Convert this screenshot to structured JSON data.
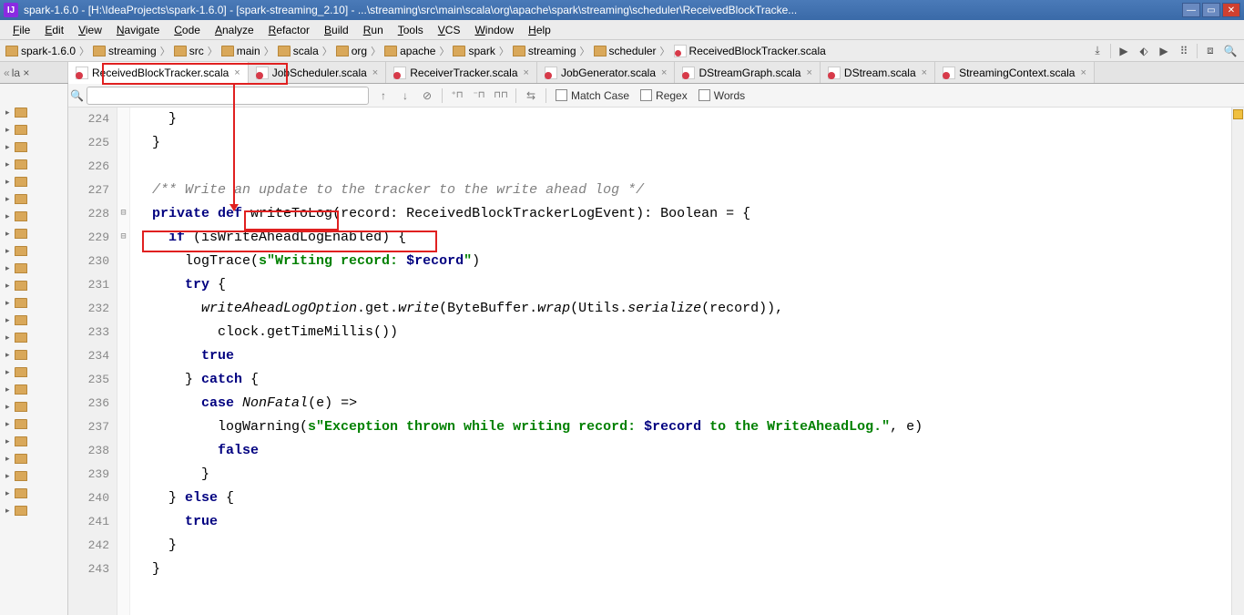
{
  "titlebar": {
    "text": "spark-1.6.0 - [H:\\IdeaProjects\\spark-1.6.0] - [spark-streaming_2.10] - ...\\streaming\\src\\main\\scala\\org\\apache\\spark\\streaming\\scheduler\\ReceivedBlockTracke..."
  },
  "menus": [
    "File",
    "Edit",
    "View",
    "Navigate",
    "Code",
    "Analyze",
    "Refactor",
    "Build",
    "Run",
    "Tools",
    "VCS",
    "Window",
    "Help"
  ],
  "breadcrumbs": [
    "spark-1.6.0",
    "streaming",
    "src",
    "main",
    "scala",
    "org",
    "apache",
    "spark",
    "streaming",
    "scheduler",
    "ReceivedBlockTracker.scala"
  ],
  "tabs_left_stub": "la ×",
  "tabs": [
    {
      "label": "ReceivedBlockTracker.scala",
      "active": true
    },
    {
      "label": "JobScheduler.scala",
      "active": false
    },
    {
      "label": "ReceiverTracker.scala",
      "active": false
    },
    {
      "label": "JobGenerator.scala",
      "active": false
    },
    {
      "label": "DStreamGraph.scala",
      "active": false
    },
    {
      "label": "DStream.scala",
      "active": false
    },
    {
      "label": "StreamingContext.scala",
      "active": false
    }
  ],
  "findbar": {
    "search_value": "",
    "match_case": "Match Case",
    "regex": "Regex",
    "words": "Words"
  },
  "line_start": 224,
  "code_lines": [
    {
      "n": 224,
      "seg": [
        {
          "t": "    }",
          "c": ""
        }
      ]
    },
    {
      "n": 225,
      "seg": [
        {
          "t": "  }",
          "c": ""
        }
      ]
    },
    {
      "n": 226,
      "seg": [
        {
          "t": "",
          "c": ""
        }
      ]
    },
    {
      "n": 227,
      "seg": [
        {
          "t": "  /** Write an update to the tracker to the write ahead log */",
          "c": "cm"
        }
      ]
    },
    {
      "n": 228,
      "seg": [
        {
          "t": "  ",
          "c": ""
        },
        {
          "t": "private def",
          "c": "kw"
        },
        {
          "t": " writeToLog(record: ReceivedBlockTrackerLogEvent): Boolean = {",
          "c": ""
        }
      ]
    },
    {
      "n": 229,
      "seg": [
        {
          "t": "    ",
          "c": ""
        },
        {
          "t": "if",
          "c": "kw"
        },
        {
          "t": " (isWriteAheadLogEnabled) {",
          "c": ""
        }
      ]
    },
    {
      "n": 230,
      "seg": [
        {
          "t": "      logTrace(",
          "c": ""
        },
        {
          "t": "s\"Writing record: ",
          "c": "st"
        },
        {
          "t": "$record",
          "c": "kw"
        },
        {
          "t": "\"",
          "c": "st"
        },
        {
          "t": ")",
          "c": ""
        }
      ]
    },
    {
      "n": 231,
      "seg": [
        {
          "t": "      ",
          "c": ""
        },
        {
          "t": "try",
          "c": "kw"
        },
        {
          "t": " {",
          "c": ""
        }
      ]
    },
    {
      "n": 232,
      "seg": [
        {
          "t": "        ",
          "c": ""
        },
        {
          "t": "writeAheadLogOption",
          "c": "id"
        },
        {
          "t": ".get.",
          "c": ""
        },
        {
          "t": "write",
          "c": "id"
        },
        {
          "t": "(ByteBuffer.",
          "c": ""
        },
        {
          "t": "wrap",
          "c": "id"
        },
        {
          "t": "(Utils.",
          "c": ""
        },
        {
          "t": "serialize",
          "c": "id"
        },
        {
          "t": "(record)),",
          "c": ""
        }
      ]
    },
    {
      "n": 233,
      "seg": [
        {
          "t": "          clock.getTimeMillis())",
          "c": ""
        }
      ]
    },
    {
      "n": 234,
      "seg": [
        {
          "t": "        ",
          "c": ""
        },
        {
          "t": "true",
          "c": "kw"
        }
      ]
    },
    {
      "n": 235,
      "seg": [
        {
          "t": "      } ",
          "c": ""
        },
        {
          "t": "catch",
          "c": "kw"
        },
        {
          "t": " {",
          "c": ""
        }
      ]
    },
    {
      "n": 236,
      "seg": [
        {
          "t": "        ",
          "c": ""
        },
        {
          "t": "case",
          "c": "kw"
        },
        {
          "t": " ",
          "c": ""
        },
        {
          "t": "NonFatal",
          "c": "id"
        },
        {
          "t": "(e) =>",
          "c": ""
        }
      ]
    },
    {
      "n": 237,
      "seg": [
        {
          "t": "          logWarning(",
          "c": ""
        },
        {
          "t": "s\"Exception thrown while writing record: ",
          "c": "st"
        },
        {
          "t": "$record",
          "c": "kw"
        },
        {
          "t": " to the WriteAheadLog.\"",
          "c": "st"
        },
        {
          "t": ", e)",
          "c": ""
        }
      ]
    },
    {
      "n": 238,
      "seg": [
        {
          "t": "          ",
          "c": ""
        },
        {
          "t": "false",
          "c": "kw"
        }
      ]
    },
    {
      "n": 239,
      "seg": [
        {
          "t": "        }",
          "c": ""
        }
      ]
    },
    {
      "n": 240,
      "seg": [
        {
          "t": "    } ",
          "c": ""
        },
        {
          "t": "else",
          "c": "kw"
        },
        {
          "t": " {",
          "c": ""
        }
      ]
    },
    {
      "n": 241,
      "seg": [
        {
          "t": "      ",
          "c": ""
        },
        {
          "t": "true",
          "c": "kw"
        }
      ]
    },
    {
      "n": 242,
      "seg": [
        {
          "t": "    }",
          "c": ""
        }
      ]
    },
    {
      "n": 243,
      "seg": [
        {
          "t": "  }",
          "c": ""
        }
      ]
    }
  ]
}
